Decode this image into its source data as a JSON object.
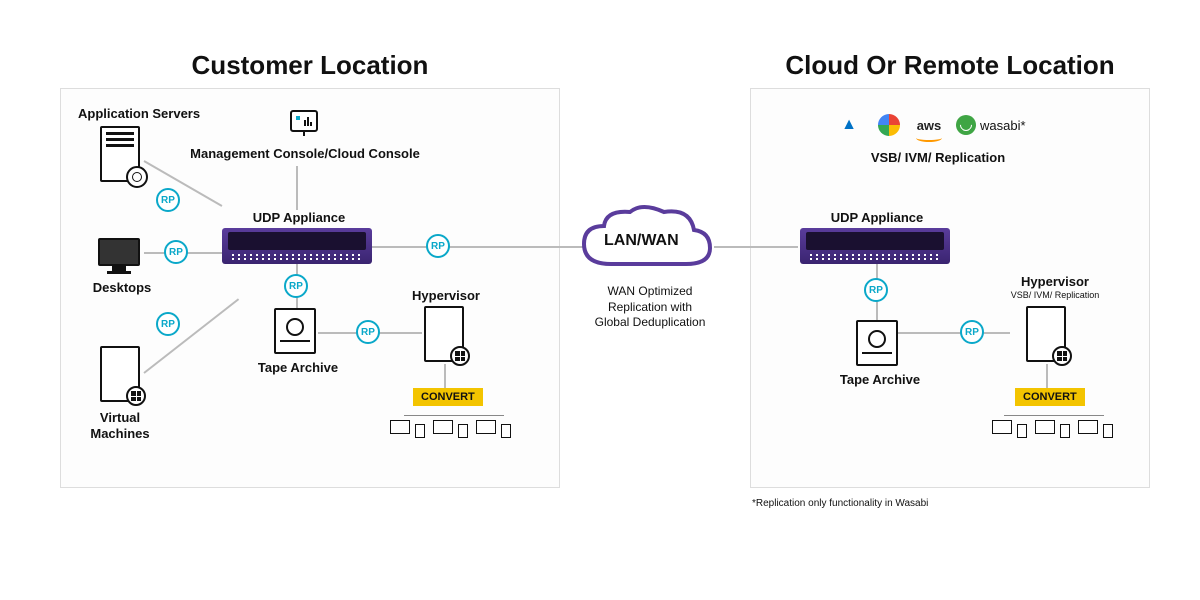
{
  "left": {
    "title": "Customer Location",
    "app_servers": "Application Servers",
    "desktops": "Desktops",
    "virtual_machines": "Virtual\nMachines",
    "mgmt_console": "Management Console/Cloud Console",
    "udp_appliance": "UDP Appliance",
    "tape_archive": "Tape Archive",
    "hypervisor": "Hypervisor",
    "convert": "CONVERT"
  },
  "center": {
    "cloud_text": "LAN/WAN",
    "caption": "WAN Optimized\nReplication with\nGlobal Deduplication"
  },
  "right": {
    "title": "Cloud Or Remote Location",
    "vsb": "VSB/ IVM/ Replication",
    "udp_appliance": "UDP Appliance",
    "tape_archive": "Tape Archive",
    "hypervisor": "Hypervisor",
    "hyp_sub": "VSB/ IVM/ Replication",
    "convert": "CONVERT",
    "providers": {
      "aws": "aws",
      "wasabi": "wasabi*"
    }
  },
  "rp": "RP",
  "footnote": "*Replication only functionality in Wasabi"
}
